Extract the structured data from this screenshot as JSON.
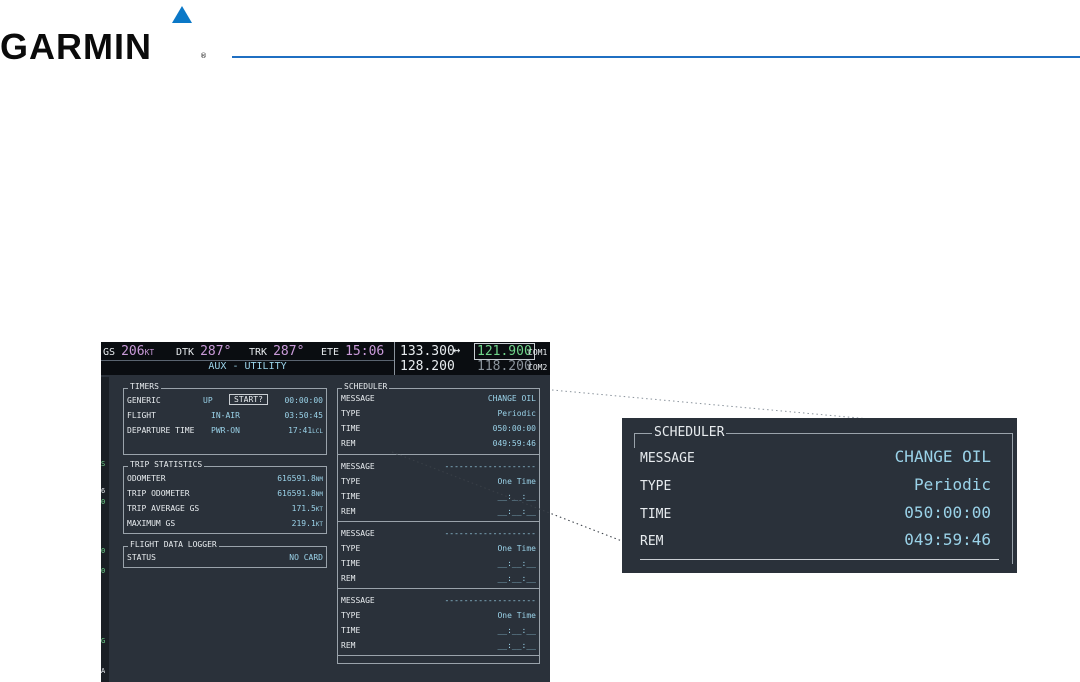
{
  "brand": {
    "name": "GARMIN",
    "reg": "®",
    "accent": "#1f6fc2",
    "triangle_color": "#0b78c7"
  },
  "screen": {
    "nav": {
      "gs_label": "GS",
      "gs_value": "206",
      "gs_unit": "KT",
      "dtk_label": "DTK",
      "dtk_value": "287°",
      "trk_label": "TRK",
      "trk_value": "287°",
      "ete_label": "ETE",
      "ete_value": "15:06"
    },
    "page_title": "AUX - UTILITY",
    "com1": {
      "active": "133.300",
      "swap_icon": "↔",
      "standby": "121.900",
      "label": "COM1"
    },
    "com2": {
      "active": "128.200",
      "standby": "118.200",
      "label": "COM2"
    },
    "left_strip": [
      "S",
      "6",
      "0",
      "0",
      "0",
      "G",
      "A"
    ],
    "timers": {
      "header": "TIMERS",
      "rows": [
        {
          "label": "GENERIC",
          "mode": "UP",
          "button": "START?",
          "value": "00:00:00"
        },
        {
          "label": "FLIGHT",
          "mode": "IN-AIR",
          "value": "03:50:45"
        },
        {
          "label": "DEPARTURE TIME",
          "mode": "PWR-ON",
          "value": "17:41",
          "unit": "LCL"
        }
      ]
    },
    "trip": {
      "header": "TRIP STATISTICS",
      "rows": [
        {
          "label": "ODOMETER",
          "value": "616591.8",
          "unit": "NM"
        },
        {
          "label": "TRIP ODOMETER",
          "value": "616591.8",
          "unit": "NM"
        },
        {
          "label": "TRIP AVERAGE GS",
          "value": "171.5",
          "unit": "KT"
        },
        {
          "label": "MAXIMUM GS",
          "value": "219.1",
          "unit": "KT"
        }
      ]
    },
    "logger": {
      "header": "FLIGHT DATA LOGGER",
      "label": "STATUS",
      "value": "NO CARD"
    },
    "scheduler": {
      "header": "SCHEDULER",
      "labels": {
        "message": "MESSAGE",
        "type": "TYPE",
        "time": "TIME",
        "rem": "REM"
      },
      "entries": [
        {
          "message": "CHANGE OIL",
          "type": "Periodic",
          "time": "050:00:00",
          "rem": "049:59:46"
        },
        {
          "message": "-------------------",
          "type": "One Time",
          "time": "__:__:__",
          "rem": "__:__:__"
        },
        {
          "message": "-------------------",
          "type": "One Time",
          "time": "__:__:__",
          "rem": "__:__:__"
        },
        {
          "message": "-------------------",
          "type": "One Time",
          "time": "__:__:__",
          "rem": "__:__:__"
        }
      ]
    }
  },
  "inset": {
    "header": "SCHEDULER",
    "rows": [
      {
        "label": "MESSAGE",
        "value": "CHANGE OIL"
      },
      {
        "label": "TYPE",
        "value": "Periodic"
      },
      {
        "label": "TIME",
        "value": "050:00:00"
      },
      {
        "label": "REM",
        "value": "049:59:46"
      }
    ]
  }
}
